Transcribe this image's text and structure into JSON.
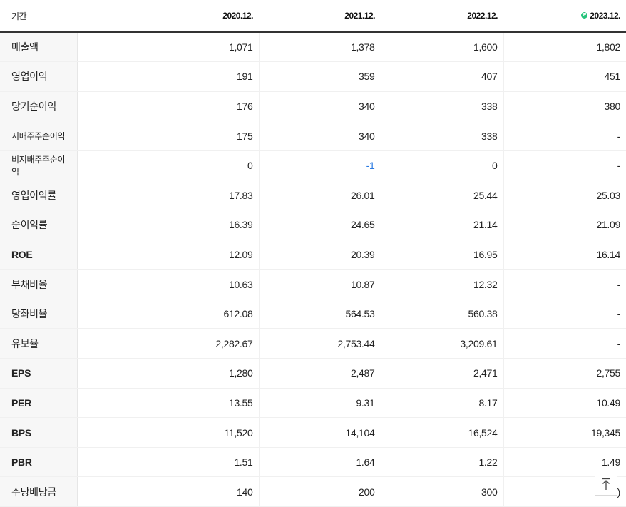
{
  "header": {
    "label": "기간",
    "columns": [
      "2020.12.",
      "2021.12.",
      "2022.12.",
      "2023.12."
    ],
    "estimate_badge": "E"
  },
  "rows": [
    {
      "label": "매출액",
      "values": [
        "1,071",
        "1,378",
        "1,600",
        "1,802"
      ]
    },
    {
      "label": "영업이익",
      "values": [
        "191",
        "359",
        "407",
        "451"
      ]
    },
    {
      "label": "당기순이익",
      "values": [
        "176",
        "340",
        "338",
        "380"
      ]
    },
    {
      "label": "지배주주순이익",
      "values": [
        "175",
        "340",
        "338",
        "-"
      ]
    },
    {
      "label": "비지배주주순이익",
      "values": [
        "0",
        "-1",
        "0",
        "-"
      ]
    },
    {
      "label": "영업이익률",
      "values": [
        "17.83",
        "26.01",
        "25.44",
        "25.03"
      ]
    },
    {
      "label": "순이익률",
      "values": [
        "16.39",
        "24.65",
        "21.14",
        "21.09"
      ]
    },
    {
      "label": "ROE",
      "values": [
        "12.09",
        "20.39",
        "16.95",
        "16.14"
      ]
    },
    {
      "label": "부채비율",
      "values": [
        "10.63",
        "10.87",
        "12.32",
        "-"
      ]
    },
    {
      "label": "당좌비율",
      "values": [
        "612.08",
        "564.53",
        "560.38",
        "-"
      ]
    },
    {
      "label": "유보율",
      "values": [
        "2,282.67",
        "2,753.44",
        "3,209.61",
        "-"
      ]
    },
    {
      "label": "EPS",
      "values": [
        "1,280",
        "2,487",
        "2,471",
        "2,755"
      ]
    },
    {
      "label": "PER",
      "values": [
        "13.55",
        "9.31",
        "8.17",
        "10.49"
      ]
    },
    {
      "label": "BPS",
      "values": [
        "11,520",
        "14,104",
        "16,524",
        "19,345"
      ]
    },
    {
      "label": "PBR",
      "values": [
        "1.51",
        "1.64",
        "1.22",
        "1.49"
      ]
    },
    {
      "label": "주당배당금",
      "values": [
        "140",
        "200",
        "300",
        ")"
      ]
    }
  ],
  "colors": {
    "negative": "#2a7ae2",
    "estimate_badge": "#27c47c"
  },
  "icons": {
    "scroll_top": "arrow-up-to-line-icon"
  }
}
